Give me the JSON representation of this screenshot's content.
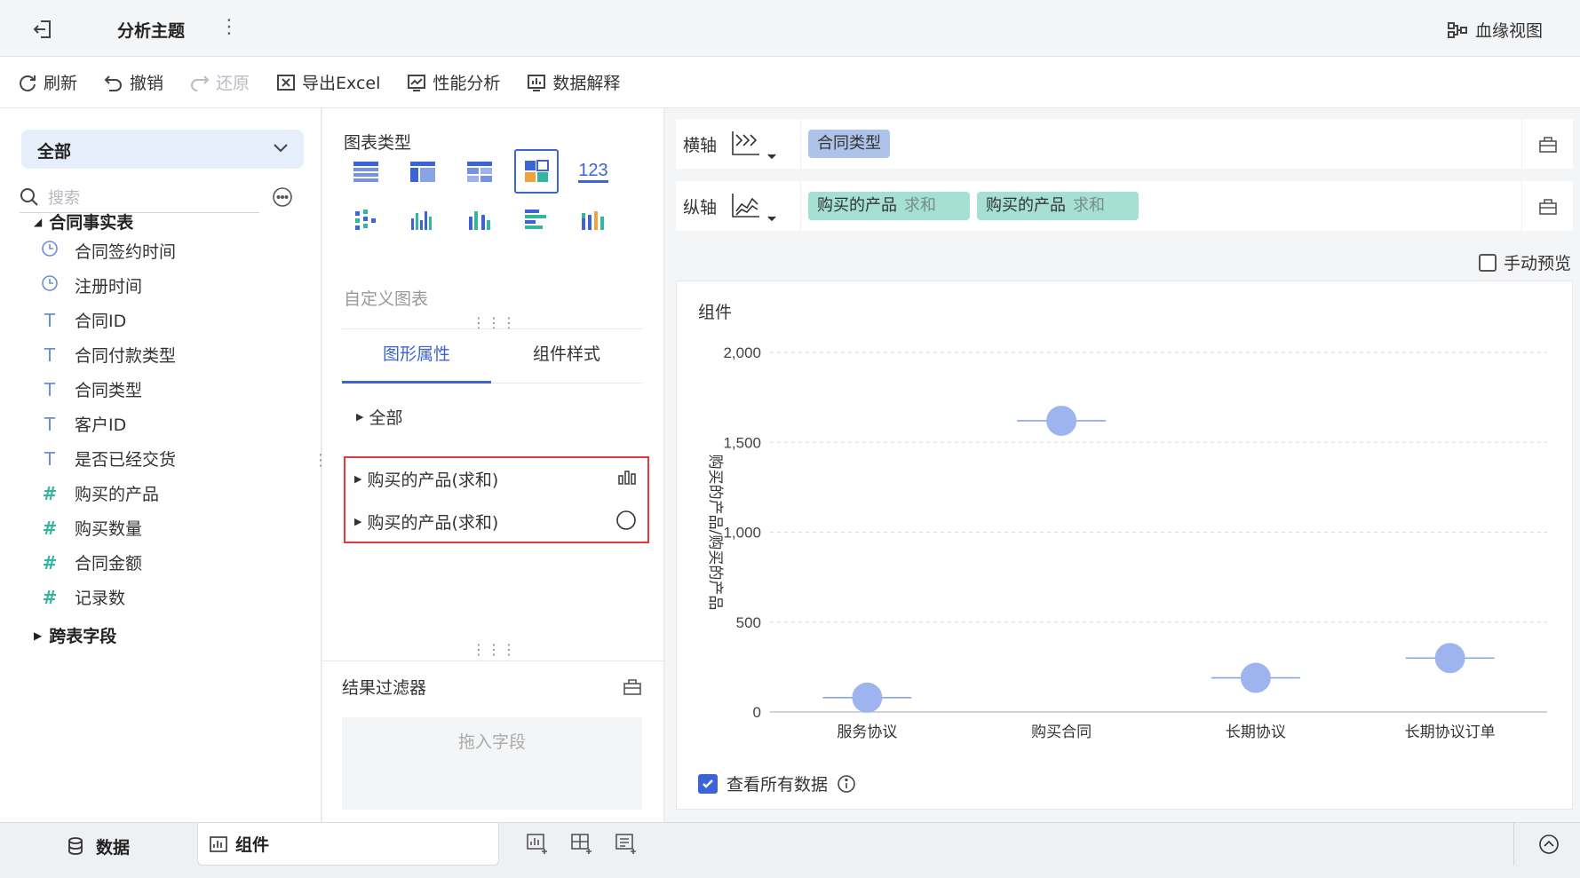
{
  "header": {
    "title": "分析主题",
    "lineage_label": "血缘视图"
  },
  "toolbar": {
    "refresh": "刷新",
    "undo": "撤销",
    "redo": "还原",
    "export_excel": "导出Excel",
    "performance": "性能分析",
    "data_explain": "数据解释"
  },
  "left": {
    "scope": "全部",
    "search_placeholder": "搜索",
    "group_main": "合同事实表",
    "fields": [
      {
        "label": "合同签约时间",
        "type": "date"
      },
      {
        "label": "注册时间",
        "type": "date"
      },
      {
        "label": "合同ID",
        "type": "text"
      },
      {
        "label": "合同付款类型",
        "type": "text"
      },
      {
        "label": "合同类型",
        "type": "text"
      },
      {
        "label": "客户ID",
        "type": "text"
      },
      {
        "label": "是否已经交货",
        "type": "text"
      },
      {
        "label": "购买的产品",
        "type": "number"
      },
      {
        "label": "购买数量",
        "type": "number"
      },
      {
        "label": "合同金额",
        "type": "number"
      },
      {
        "label": "记录数",
        "type": "number"
      }
    ],
    "group_cross": "跨表字段"
  },
  "middle": {
    "chart_type_title": "图表类型",
    "chart_type_icon_names": [
      "table-icon",
      "pivot-table-icon",
      "cross-table-icon",
      "multi-chart-icon",
      "kpi-icon",
      "scatter-bar-icon",
      "column-chart-icon",
      "grouped-column-icon",
      "bar-chart-icon",
      "stacked-column-icon"
    ],
    "kpi_icon_text": "123",
    "custom_chart": "自定义图表",
    "tab_graph": "图形属性",
    "tab_style": "组件样式",
    "prop_all": "全部",
    "prop_items": [
      "购买的产品(求和)",
      "购买的产品(求和)"
    ],
    "prop_icons": [
      "bar-shape-icon",
      "circle-shape-icon"
    ],
    "filter_title": "结果过滤器",
    "filter_placeholder": "拖入字段"
  },
  "right": {
    "x_axis_label": "横轴",
    "y_axis_label": "纵轴",
    "x_fields": [
      {
        "name": "合同类型"
      }
    ],
    "y_fields": [
      {
        "name": "购买的产品",
        "agg": "求和"
      },
      {
        "name": "购买的产品",
        "agg": "求和"
      }
    ],
    "manual_preview": "手动预览",
    "chart_title": "组件",
    "view_all_data": "查看所有数据",
    "accent_color": "#3c64d6",
    "point_color": "#9db4ef"
  },
  "chart_data": {
    "type": "scatter",
    "categories": [
      "服务协议",
      "购买合同",
      "长期协议",
      "长期协议订单"
    ],
    "values": [
      80,
      1620,
      190,
      300
    ],
    "ylabel": "购买的产品/购买的产品",
    "ylim": [
      0,
      2000
    ],
    "yticks": [
      0,
      500,
      1000,
      1500,
      2000
    ],
    "ytick_labels": [
      "0",
      "500",
      "1,000",
      "1,500",
      "2,000"
    ],
    "grid": true
  },
  "bottom": {
    "tab_data": "数据",
    "tab_component": "组件"
  }
}
